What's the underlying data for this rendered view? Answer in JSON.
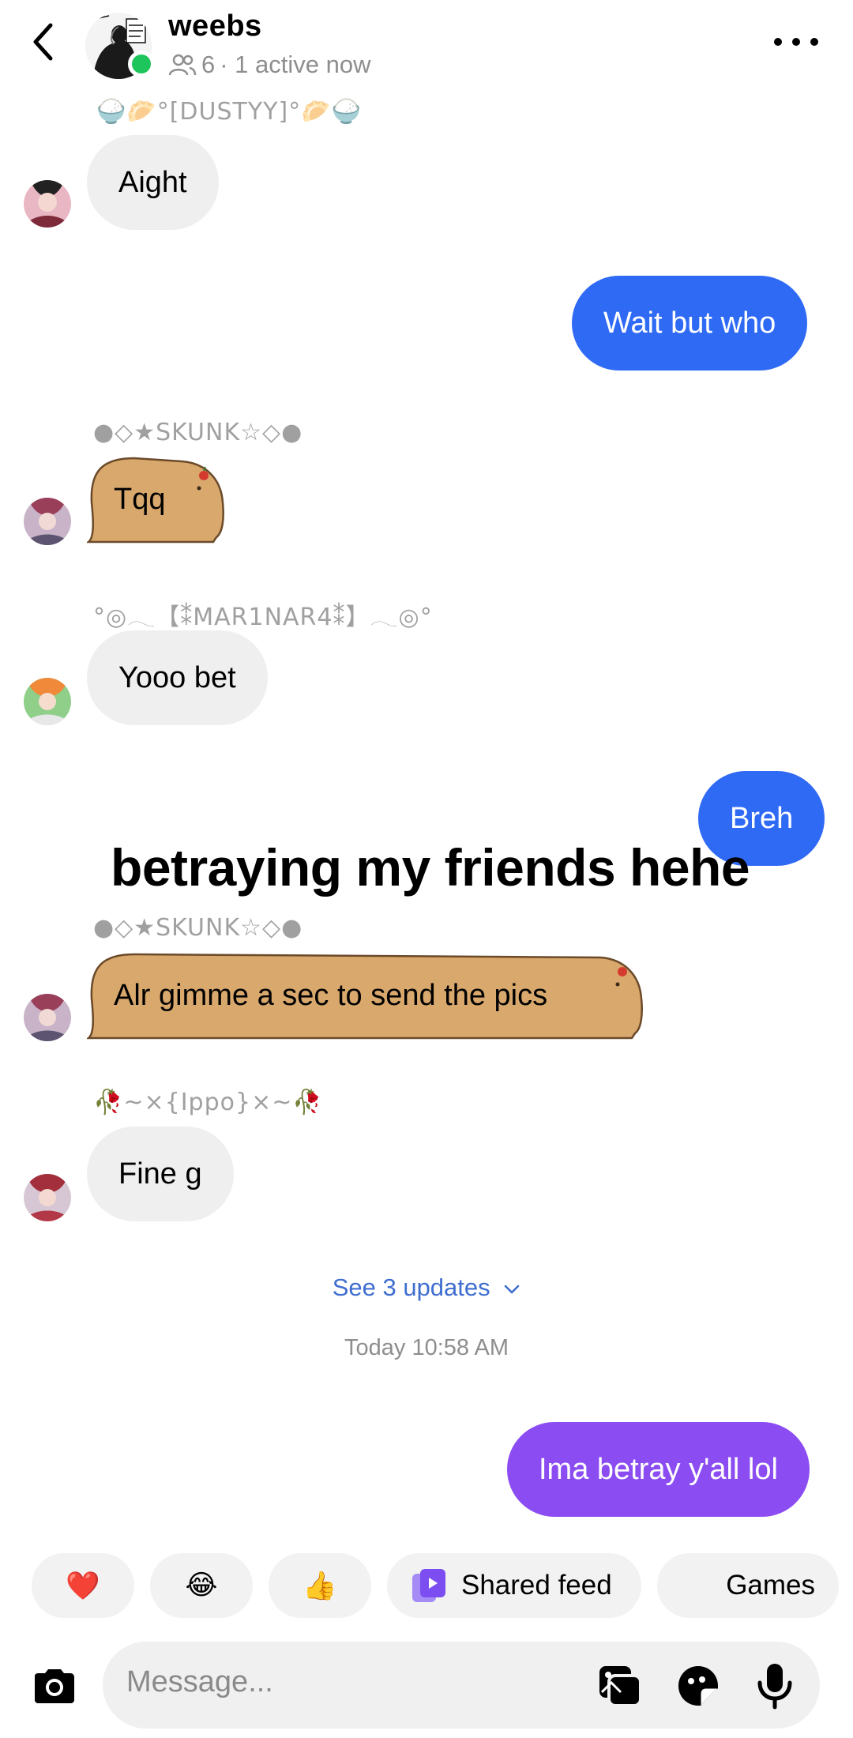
{
  "header": {
    "title": "weebs",
    "member_count": "6",
    "status": "· 1 active now"
  },
  "messages": [
    {
      "sender": "🍚🥟°[DUSTYY]°🥟🍚",
      "text": "Aight"
    },
    {
      "text": "Wait but who",
      "outgoing": true,
      "color": "#2f6af5"
    },
    {
      "sender": "●◇★SKUNK☆◇●",
      "text": "Tqq"
    },
    {
      "sender": "°◎𓂃【⁑MAR1NAR4⁑】𓂃◎°",
      "text": "Yooo bet"
    },
    {
      "text": "Breh",
      "outgoing": true,
      "color": "#2f6af5"
    },
    {
      "sender": "●◇★SKUNK☆◇●",
      "text": "Alr gimme a sec to send the pics"
    },
    {
      "sender": "🥀~×{Ippo}×~🥀",
      "text": "Fine g"
    },
    {
      "text": "Ima betray y'all lol",
      "outgoing": true,
      "color": "#8b4cf2"
    }
  ],
  "overlay_caption": "betraying my friends hehe",
  "see_updates": "See 3 updates",
  "timestamp": "Today 10:58 AM",
  "quick_reactions": {
    "heart": "❤️",
    "laugh": "😂",
    "thumbs": "👍",
    "shared_feed": "Shared feed",
    "games": "Games"
  },
  "composer": {
    "placeholder": "Message..."
  },
  "colors": {
    "blue_bubble": "#2f6af5",
    "purple_bubble": "#8b4cf2",
    "capybara": "#d9a86c",
    "online": "#1ec45c",
    "link": "#3f6ed0"
  }
}
